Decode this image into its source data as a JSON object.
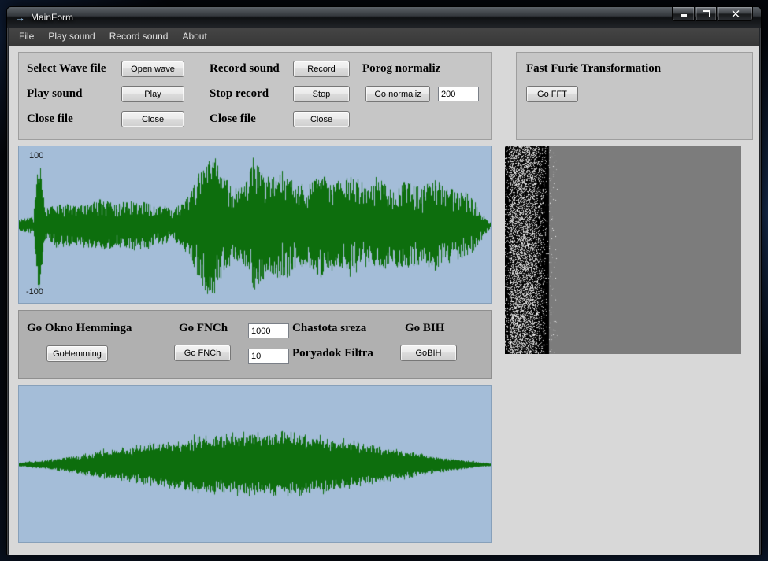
{
  "window": {
    "title": "MainForm"
  },
  "menu": {
    "items": [
      {
        "label": "File"
      },
      {
        "label": "Play sound"
      },
      {
        "label": "Record sound"
      },
      {
        "label": "About"
      }
    ]
  },
  "controls": {
    "col1": [
      {
        "label": "Select Wave file",
        "button": "Open wave"
      },
      {
        "label": "Play sound",
        "button": "Play"
      },
      {
        "label": "Close file",
        "button": "Close"
      }
    ],
    "col2": [
      {
        "label": "Record sound",
        "button": "Record"
      },
      {
        "label": "Stop record",
        "button": "Stop"
      },
      {
        "label": "Close file",
        "button": "Close"
      }
    ],
    "normaliz": {
      "label": "Porog normaliz",
      "button": "Go normaliz",
      "value": "200"
    }
  },
  "fft": {
    "title": "Fast Furie Transformation",
    "button": "Go FFT"
  },
  "wave1": {
    "y_max": "100",
    "y_min": "-100"
  },
  "filter": {
    "hemming_label": "Go Okno Hemminga",
    "hemming_button": "GoHemming",
    "fnch_label": "Go FNCh",
    "fnch_button": "Go FNCh",
    "cutoff_value": "1000",
    "cutoff_label": "Chastota sreza",
    "order_value": "10",
    "order_label": "Poryadok Filtra",
    "bih_label": "Go BIH",
    "bih_button": "GoBIH"
  },
  "colors": {
    "waveform": "#0d6e0d",
    "wave_bg": "#a4bdd8",
    "spectro_fill": "#7c7c7c"
  },
  "waveforms": {
    "wave1_envelope": [
      [
        0,
        0.08
      ],
      [
        0.03,
        0.12
      ],
      [
        0.042,
        0.95
      ],
      [
        0.055,
        0.2
      ],
      [
        0.08,
        0.3
      ],
      [
        0.13,
        0.27
      ],
      [
        0.17,
        0.33
      ],
      [
        0.21,
        0.3
      ],
      [
        0.25,
        0.34
      ],
      [
        0.29,
        0.27
      ],
      [
        0.33,
        0.22
      ],
      [
        0.36,
        0.4
      ],
      [
        0.4,
        0.97
      ],
      [
        0.43,
        0.75
      ],
      [
        0.455,
        0.45
      ],
      [
        0.48,
        0.55
      ],
      [
        0.5,
        0.92
      ],
      [
        0.525,
        0.6
      ],
      [
        0.55,
        0.72
      ],
      [
        0.58,
        0.62
      ],
      [
        0.61,
        0.52
      ],
      [
        0.64,
        0.7
      ],
      [
        0.67,
        0.58
      ],
      [
        0.7,
        0.66
      ],
      [
        0.73,
        0.54
      ],
      [
        0.76,
        0.62
      ],
      [
        0.79,
        0.55
      ],
      [
        0.82,
        0.6
      ],
      [
        0.85,
        0.52
      ],
      [
        0.88,
        0.58
      ],
      [
        0.91,
        0.5
      ],
      [
        0.94,
        0.45
      ],
      [
        0.965,
        0.35
      ],
      [
        0.985,
        0.15
      ],
      [
        1,
        0.04
      ]
    ],
    "wave2_envelope": [
      [
        0,
        0.03
      ],
      [
        0.03,
        0.05
      ],
      [
        0.07,
        0.08
      ],
      [
        0.12,
        0.13
      ],
      [
        0.17,
        0.19
      ],
      [
        0.22,
        0.25
      ],
      [
        0.27,
        0.3
      ],
      [
        0.32,
        0.34
      ],
      [
        0.37,
        0.38
      ],
      [
        0.42,
        0.42
      ],
      [
        0.47,
        0.44
      ],
      [
        0.52,
        0.46
      ],
      [
        0.56,
        0.48
      ],
      [
        0.6,
        0.45
      ],
      [
        0.64,
        0.41
      ],
      [
        0.68,
        0.37
      ],
      [
        0.72,
        0.32
      ],
      [
        0.77,
        0.26
      ],
      [
        0.82,
        0.2
      ],
      [
        0.87,
        0.14
      ],
      [
        0.92,
        0.09
      ],
      [
        0.96,
        0.05
      ],
      [
        1,
        0.02
      ]
    ]
  }
}
